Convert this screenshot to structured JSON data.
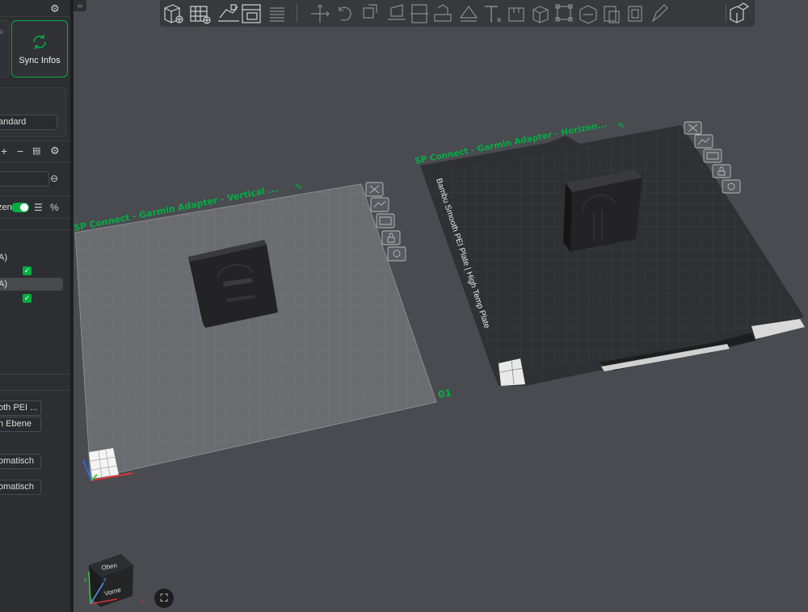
{
  "left_panel": {
    "sync_label": "Sync Infos",
    "plate_type_value": "andard",
    "search_placeholder": "",
    "toggle_label": "zen",
    "objects": [
      {
        "label": "A)"
      },
      {
        "label": "A)"
      }
    ],
    "plate_options": {
      "plate_type": "oth PEI ...",
      "first_layer": "h Ebene",
      "option1": "omatisch",
      "option2": "omatisch"
    }
  },
  "toolbar": {
    "icons": [
      "add-cube-icon",
      "add-plate-icon",
      "auto-arrange-icon",
      "arrange-icon",
      "layers-icon",
      "move-icon",
      "rotate-icon",
      "scale-icon",
      "lay-on-face-icon",
      "cut-icon",
      "support-paint-icon",
      "seam-paint-icon",
      "text-icon",
      "measure-icon",
      "box-icon",
      "corner-icon",
      "emboss-icon",
      "mesh-boolean-icon",
      "variable-layer-icon",
      "edit-icon",
      "assembly-icon"
    ]
  },
  "plates": [
    {
      "label": "SP Connect - Garmin Adapter - Vertical ...",
      "number": "01"
    },
    {
      "label": "SP Connect - Garmin Adapter - Horizon...",
      "bed_text": "Bambu Smooth PEI Plate | High Temp Plate"
    }
  ],
  "nav_cube": {
    "top": "Oben",
    "front": "Vorne"
  },
  "colors": {
    "accent": "#00ae42",
    "background": "#4a4b50",
    "panel": "#2d2e31",
    "toolbar": "#38393c"
  }
}
